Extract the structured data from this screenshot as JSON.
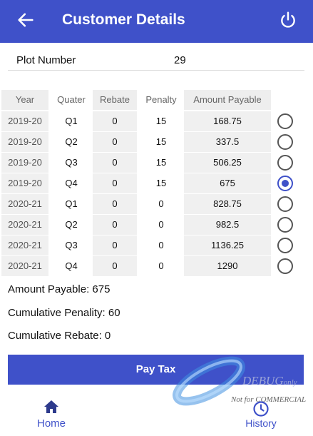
{
  "header": {
    "title": "Customer Details",
    "back_icon": "arrow-left-icon",
    "power_icon": "power-icon"
  },
  "plot": {
    "label": "Plot Number",
    "value": "29"
  },
  "table": {
    "headers": {
      "year": "Year",
      "quarter": "Quater",
      "rebate": "Rebate",
      "penalty": "Penalty",
      "amount": "Amount Payable"
    },
    "rows": [
      {
        "year": "2019-20",
        "quarter": "Q1",
        "rebate": "0",
        "penalty": "15",
        "amount": "168.75",
        "selected": false
      },
      {
        "year": "2019-20",
        "quarter": "Q2",
        "rebate": "0",
        "penalty": "15",
        "amount": "337.5",
        "selected": false
      },
      {
        "year": "2019-20",
        "quarter": "Q3",
        "rebate": "0",
        "penalty": "15",
        "amount": "506.25",
        "selected": false
      },
      {
        "year": "2019-20",
        "quarter": "Q4",
        "rebate": "0",
        "penalty": "15",
        "amount": "675",
        "selected": true
      },
      {
        "year": "2020-21",
        "quarter": "Q1",
        "rebate": "0",
        "penalty": "0",
        "amount": "828.75",
        "selected": false
      },
      {
        "year": "2020-21",
        "quarter": "Q2",
        "rebate": "0",
        "penalty": "0",
        "amount": "982.5",
        "selected": false
      },
      {
        "year": "2020-21",
        "quarter": "Q3",
        "rebate": "0",
        "penalty": "0",
        "amount": "1136.25",
        "selected": false
      },
      {
        "year": "2020-21",
        "quarter": "Q4",
        "rebate": "0",
        "penalty": "0",
        "amount": "1290",
        "selected": false
      }
    ]
  },
  "summary": {
    "amount_payable": "Amount Payable: 675",
    "cumulative_penalty": "Cumulative Penality: 60",
    "cumulative_rebate": "Cumulative Rebate: 0"
  },
  "pay_button": "Pay Tax",
  "nav": {
    "home": {
      "label": "Home",
      "icon": "home-icon"
    },
    "history": {
      "label": "History",
      "icon": "clock-icon"
    }
  },
  "watermark": {
    "line1": "DEBUG",
    "line1_suffix": "only",
    "line2": "Not for COMMERCIAL"
  },
  "colors": {
    "primary": "#3f51c9",
    "row_shade": "#f0f0f0"
  }
}
